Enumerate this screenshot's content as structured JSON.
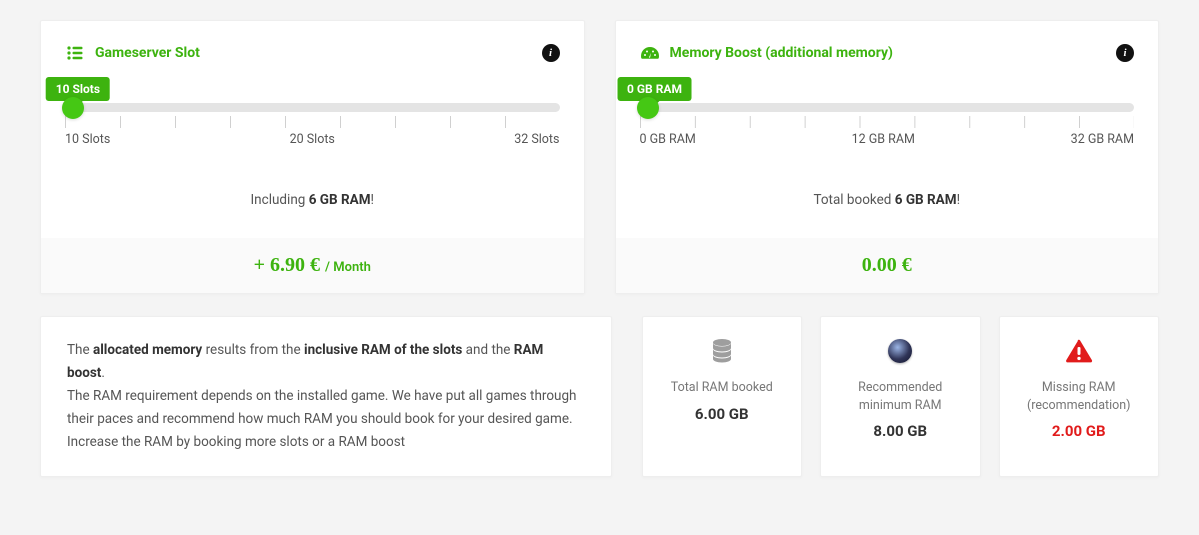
{
  "slotCard": {
    "title": "Gameserver Slot",
    "bubble": "10 Slots",
    "labelMin": "10 Slots",
    "labelMid": "20 Slots",
    "labelMax": "32 Slots",
    "includingPrefix": "Including ",
    "includingBold": "6 GB RAM",
    "includingSuffix": "!",
    "price": "+ 6.90 €",
    "priceSuffix": " / Month"
  },
  "memoryCard": {
    "title": "Memory Boost (additional memory)",
    "bubble": "0 GB RAM",
    "labelMin": "0 GB RAM",
    "labelMid": "12 GB RAM",
    "labelMax": "32 GB RAM",
    "totalPrefix": "Total booked ",
    "totalBold": "6 GB RAM",
    "totalSuffix": "!",
    "price": "0.00 €"
  },
  "info": {
    "seg1": "The ",
    "seg2": "allocated memory",
    "seg3": " results from the ",
    "seg4": "inclusive RAM of the slots",
    "seg5": " and the ",
    "seg6": "RAM boost",
    "seg7": ".",
    "line2": "The RAM requirement depends on the installed game. We have put all games through their paces and recommend how much RAM you should book for your desired game. Increase the RAM by booking more slots or a RAM boost"
  },
  "stats": {
    "total": {
      "label": "Total RAM booked",
      "value": "6.00 GB"
    },
    "recommended": {
      "label": "Recommended\nminimum RAM",
      "value": "8.00 GB"
    },
    "missing": {
      "label": "Missing RAM\n(recommendation)",
      "value": "2.00 GB"
    }
  }
}
